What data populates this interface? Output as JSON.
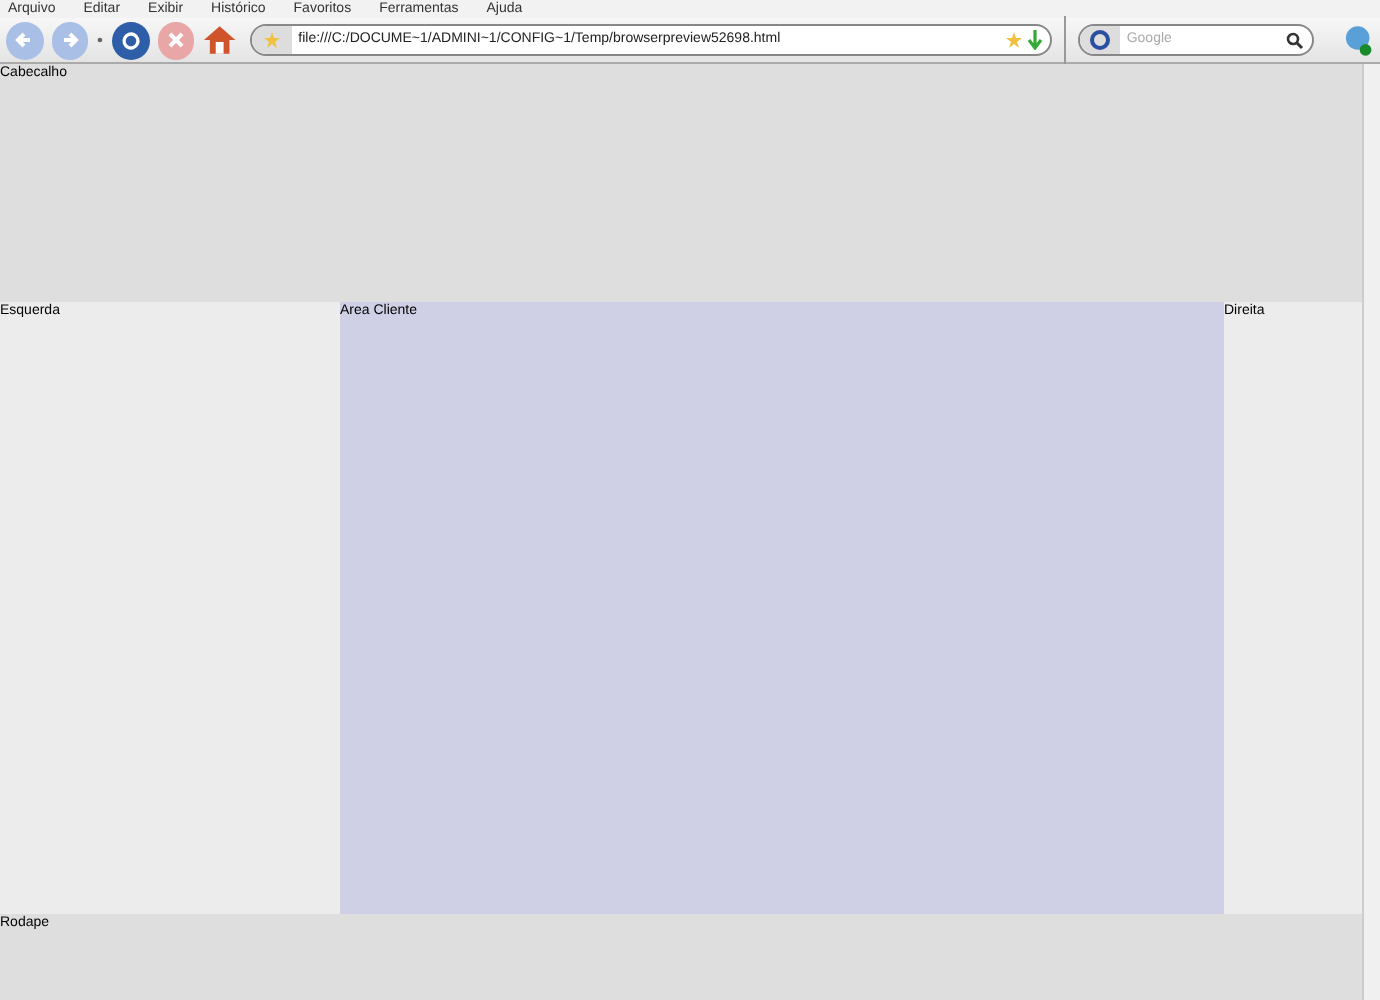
{
  "menu": [
    "Arquivo",
    "Editar",
    "Exibir",
    "Histórico",
    "Favoritos",
    "Ferramentas",
    "Ajuda"
  ],
  "address": {
    "value": "file:///C:/DOCUME~1/ADMINI~1/CONFIG~1/Temp/browserpreview52698.html"
  },
  "search": {
    "placeholder": "Google"
  },
  "page": {
    "header": "Cabecalho",
    "left": "Esquerda",
    "center": "Area Cliente",
    "right": "Direita",
    "footer": "Rodape"
  }
}
